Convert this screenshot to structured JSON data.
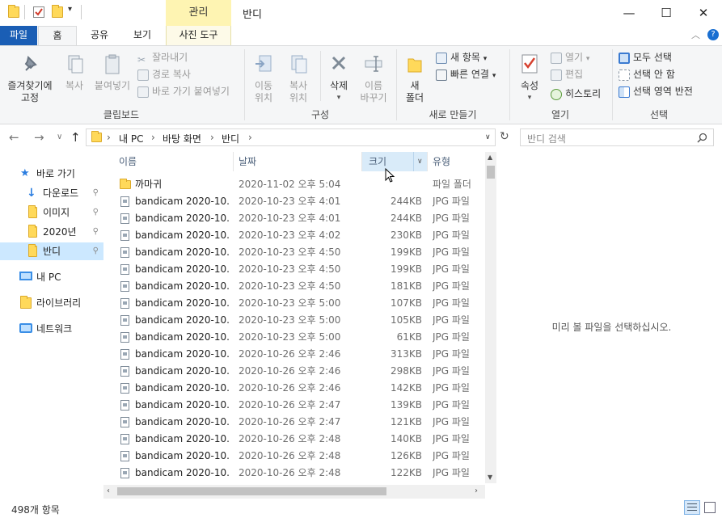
{
  "window": {
    "title": "반디",
    "contextual_tab_group": "관리",
    "minimize_glyph": "—",
    "maximize_glyph": "☐",
    "close_glyph": "✕"
  },
  "ribbon_tabs": [
    {
      "label": "파일"
    },
    {
      "label": "홈"
    },
    {
      "label": "공유"
    },
    {
      "label": "보기"
    },
    {
      "label": "사진 도구"
    }
  ],
  "clipboard": {
    "pin_label_1": "즐겨찾기에",
    "pin_label_2": "고정",
    "copy_label": "복사",
    "paste_label": "붙여넣기",
    "cut_label": "잘라내기",
    "copy_path_label": "경로 복사",
    "paste_shortcut_label": "바로 가기 붙여넣기",
    "group_label": "클립보드"
  },
  "organize": {
    "move_label_1": "이동",
    "move_label_2": "위치",
    "copyto_label_1": "복사",
    "copyto_label_2": "위치",
    "delete_label": "삭제",
    "rename_label_1": "이름",
    "rename_label_2": "바꾸기",
    "group_label": "구성"
  },
  "new_group": {
    "new_folder_label_1": "새",
    "new_folder_label_2": "폴더",
    "new_item_label": "새 항목",
    "easy_access_label": "빠른 연결",
    "group_label": "새로 만들기"
  },
  "open_group": {
    "properties_label": "속성",
    "open_label": "열기",
    "edit_label": "편집",
    "history_label": "히스토리",
    "group_label": "열기"
  },
  "select_group": {
    "select_all_label": "모두 선택",
    "select_none_label": "선택 안 함",
    "invert_label": "선택 영역 반전",
    "group_label": "선택"
  },
  "address": {
    "crumbs": [
      "내 PC",
      "바탕 화면",
      "반디"
    ],
    "search_placeholder": "반디 검색"
  },
  "nav_pane": {
    "items": [
      {
        "label": "바로 가기",
        "icon": "star-icon"
      },
      {
        "label": "다운로드",
        "icon": "download-icon"
      },
      {
        "label": "이미지",
        "icon": "folder-icon"
      },
      {
        "label": "2020년",
        "icon": "folder-icon"
      },
      {
        "label": "반디",
        "icon": "folder-icon"
      },
      {
        "label": "내 PC",
        "icon": "computer-icon"
      },
      {
        "label": "라이브러리",
        "icon": "library-icon"
      },
      {
        "label": "네트워크",
        "icon": "network-icon"
      }
    ]
  },
  "columns": {
    "name": "이름",
    "date": "날짜",
    "size": "크기",
    "type": "유형"
  },
  "files": [
    {
      "name": "까마귀",
      "date": "2020-11-02 오후 5:04",
      "size": "",
      "type": "파일 폴더",
      "kind": "folder"
    },
    {
      "name": "bandicam 2020-10...",
      "date": "2020-10-23 오후 4:01",
      "size": "244KB",
      "type": "JPG 파일",
      "kind": "jpg"
    },
    {
      "name": "bandicam 2020-10...",
      "date": "2020-10-23 오후 4:01",
      "size": "244KB",
      "type": "JPG 파일",
      "kind": "jpg"
    },
    {
      "name": "bandicam 2020-10...",
      "date": "2020-10-23 오후 4:02",
      "size": "230KB",
      "type": "JPG 파일",
      "kind": "jpg"
    },
    {
      "name": "bandicam 2020-10...",
      "date": "2020-10-23 오후 4:50",
      "size": "199KB",
      "type": "JPG 파일",
      "kind": "jpg"
    },
    {
      "name": "bandicam 2020-10...",
      "date": "2020-10-23 오후 4:50",
      "size": "199KB",
      "type": "JPG 파일",
      "kind": "jpg"
    },
    {
      "name": "bandicam 2020-10...",
      "date": "2020-10-23 오후 4:50",
      "size": "181KB",
      "type": "JPG 파일",
      "kind": "jpg"
    },
    {
      "name": "bandicam 2020-10...",
      "date": "2020-10-23 오후 5:00",
      "size": "107KB",
      "type": "JPG 파일",
      "kind": "jpg"
    },
    {
      "name": "bandicam 2020-10...",
      "date": "2020-10-23 오후 5:00",
      "size": "105KB",
      "type": "JPG 파일",
      "kind": "jpg"
    },
    {
      "name": "bandicam 2020-10...",
      "date": "2020-10-23 오후 5:00",
      "size": "61KB",
      "type": "JPG 파일",
      "kind": "jpg"
    },
    {
      "name": "bandicam 2020-10...",
      "date": "2020-10-26 오후 2:46",
      "size": "313KB",
      "type": "JPG 파일",
      "kind": "jpg"
    },
    {
      "name": "bandicam 2020-10...",
      "date": "2020-10-26 오후 2:46",
      "size": "298KB",
      "type": "JPG 파일",
      "kind": "jpg"
    },
    {
      "name": "bandicam 2020-10...",
      "date": "2020-10-26 오후 2:46",
      "size": "142KB",
      "type": "JPG 파일",
      "kind": "jpg"
    },
    {
      "name": "bandicam 2020-10...",
      "date": "2020-10-26 오후 2:47",
      "size": "139KB",
      "type": "JPG 파일",
      "kind": "jpg"
    },
    {
      "name": "bandicam 2020-10...",
      "date": "2020-10-26 오후 2:47",
      "size": "121KB",
      "type": "JPG 파일",
      "kind": "jpg"
    },
    {
      "name": "bandicam 2020-10...",
      "date": "2020-10-26 오후 2:48",
      "size": "140KB",
      "type": "JPG 파일",
      "kind": "jpg"
    },
    {
      "name": "bandicam 2020-10...",
      "date": "2020-10-26 오후 2:48",
      "size": "126KB",
      "type": "JPG 파일",
      "kind": "jpg"
    },
    {
      "name": "bandicam 2020-10...",
      "date": "2020-10-26 오후 2:48",
      "size": "122KB",
      "type": "JPG 파일",
      "kind": "jpg"
    }
  ],
  "preview": {
    "message": "미리 볼 파일을 선택하십시오."
  },
  "status": {
    "item_count": "498개 항목"
  },
  "colors": {
    "file_tab": "#1a5eb5",
    "contextual_tab": "#fef4b2",
    "selection": "#cce8ff",
    "header_hover": "#d9ebf9"
  }
}
